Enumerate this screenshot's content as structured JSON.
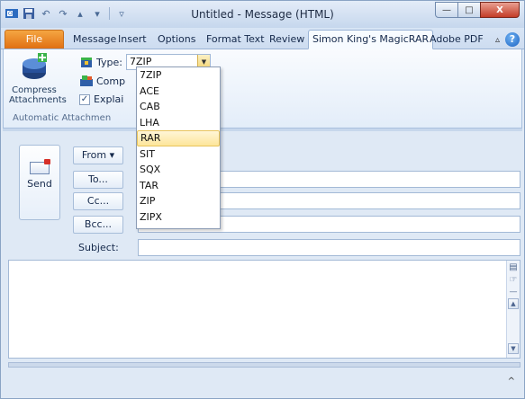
{
  "window": {
    "title": "Untitled - Message (HTML)",
    "controls": {
      "minimize": "—",
      "maximize": "□",
      "close": "X"
    }
  },
  "quick_access": {
    "icons": [
      "outlook-icon",
      "save-icon",
      "undo-icon",
      "redo-icon",
      "up-icon",
      "down-icon",
      "customize-icon"
    ]
  },
  "ribbon_tabs": [
    {
      "label": "File",
      "active": false
    },
    {
      "label": "Message",
      "active": false
    },
    {
      "label": "Insert",
      "active": false
    },
    {
      "label": "Options",
      "active": false
    },
    {
      "label": "Format Text",
      "active": false
    },
    {
      "label": "Review",
      "active": false
    },
    {
      "label": "Simon King's MagicRAR",
      "active": true
    },
    {
      "label": "Adobe PDF",
      "active": false
    }
  ],
  "ribbon": {
    "compress_label_line1": "Compress",
    "compress_label_line2": "Attachments",
    "type_label": "Type:",
    "type_value": "7ZIP",
    "comp_label": "Comp",
    "explain_label": "Explai",
    "explain_checked": true,
    "group_label": "Automatic Attachmen"
  },
  "type_options": [
    "7ZIP",
    "ACE",
    "CAB",
    "LHA",
    "RAR",
    "SIT",
    "SQX",
    "TAR",
    "ZIP",
    "ZIPX"
  ],
  "type_highlighted": "RAR",
  "compose": {
    "send_label": "Send",
    "from_label": "From ▾",
    "to_label": "To...",
    "cc_label": "Cc...",
    "bcc_label": "Bcc...",
    "subject_label": "Subject:",
    "to_value": "",
    "cc_value": "",
    "bcc_value": "",
    "subject_value": ""
  },
  "colors": {
    "file_tab": "#e06f12",
    "highlight": "#fde69a",
    "close_button": "#c33c28",
    "frame": "#dfe9f5"
  }
}
